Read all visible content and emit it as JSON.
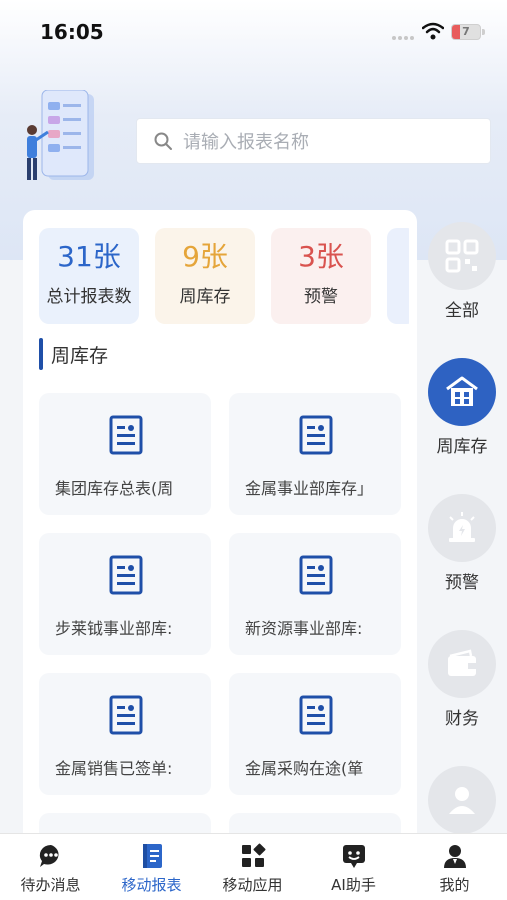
{
  "status_bar": {
    "time": "16:05",
    "battery": "7"
  },
  "search": {
    "placeholder": "请输入报表名称"
  },
  "stats": [
    {
      "value": "31张",
      "label": "总计报表数"
    },
    {
      "value": "9张",
      "label": "周库存"
    },
    {
      "value": "3张",
      "label": "预警"
    }
  ],
  "section": {
    "title": "周库存"
  },
  "reports": [
    {
      "name": "集团库存总表(周"
    },
    {
      "name": "金属事业部库存」"
    },
    {
      "name": "步莱钺事业部库:"
    },
    {
      "name": "新资源事业部库:"
    },
    {
      "name": "金属销售已签单:"
    },
    {
      "name": "金属采购在途(箪"
    }
  ],
  "side_nav": [
    {
      "label": "全部",
      "icon": "grid-icon"
    },
    {
      "label": "周库存",
      "icon": "warehouse-icon",
      "active": true
    },
    {
      "label": "预警",
      "icon": "alarm-icon"
    },
    {
      "label": "财务",
      "icon": "wallet-icon"
    },
    {
      "label": "",
      "icon": "person-icon"
    }
  ],
  "tabbar": [
    {
      "label": "待办消息",
      "icon": "chat-icon"
    },
    {
      "label": "移动报表",
      "icon": "report-book-icon",
      "active": true
    },
    {
      "label": "移动应用",
      "icon": "apps-icon"
    },
    {
      "label": "AI助手",
      "icon": "ai-assistant-icon"
    },
    {
      "label": "我的",
      "icon": "profile-icon"
    }
  ],
  "colors": {
    "accent": "#2c66c9",
    "nav_active": "#2e62c2",
    "warn": "#d9534f",
    "week": "#e5a53a"
  }
}
